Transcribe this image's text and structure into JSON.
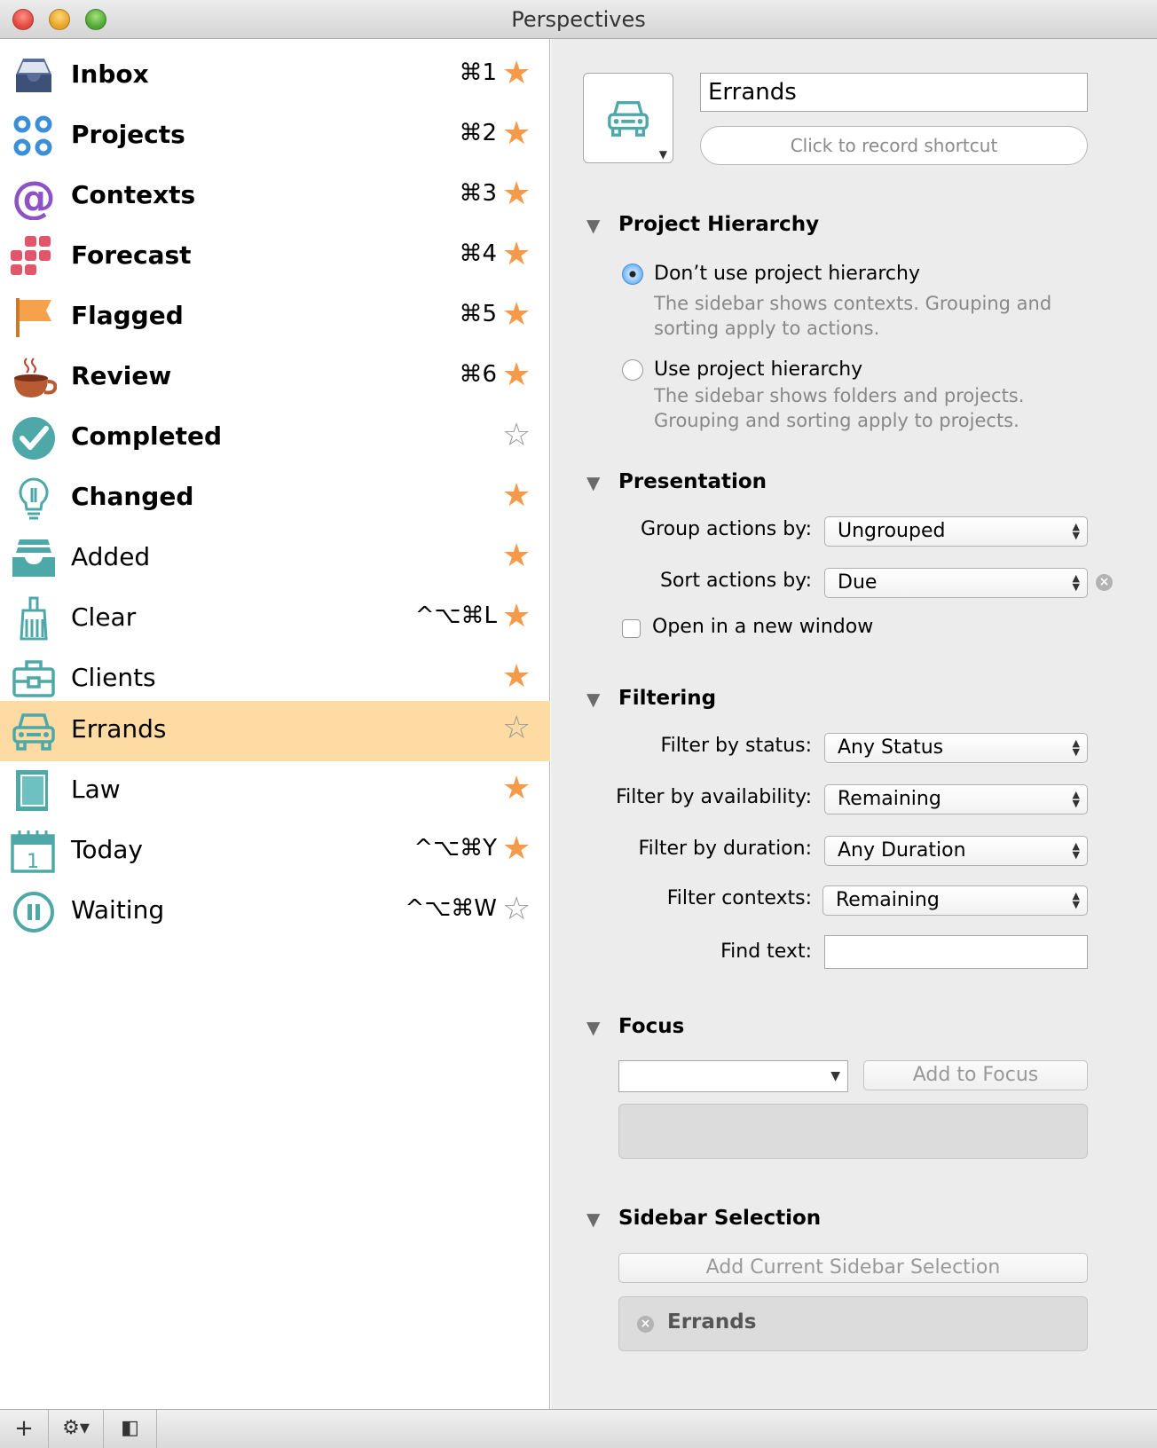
{
  "window": {
    "title": "Perspectives"
  },
  "colors": {
    "accent": "#f59a4a",
    "selection": "#fddba2",
    "teal": "#4fa8a8"
  },
  "sidebar": {
    "items": [
      {
        "label": "Inbox",
        "shortcut": "⌘1",
        "starred": true,
        "icon": "inbox-icon"
      },
      {
        "label": "Projects",
        "shortcut": "⌘2",
        "starred": true,
        "icon": "projects-icon"
      },
      {
        "label": "Contexts",
        "shortcut": "⌘3",
        "starred": true,
        "icon": "contexts-at-icon"
      },
      {
        "label": "Forecast",
        "shortcut": "⌘4",
        "starred": true,
        "icon": "forecast-grid-icon"
      },
      {
        "label": "Flagged",
        "shortcut": "⌘5",
        "starred": true,
        "icon": "flag-icon"
      },
      {
        "label": "Review",
        "shortcut": "⌘6",
        "starred": true,
        "icon": "coffee-cup-icon"
      },
      {
        "label": "Completed",
        "shortcut": "",
        "starred": false,
        "icon": "checkmark-icon"
      },
      {
        "label": "Changed",
        "shortcut": "",
        "starred": true,
        "icon": "lightbulb-icon"
      },
      {
        "label": "Added",
        "shortcut": "",
        "starred": true,
        "icon": "stacked-trays-icon"
      },
      {
        "label": "Clear",
        "shortcut": "^⌥⌘L",
        "starred": true,
        "icon": "broom-icon"
      },
      {
        "label": "Clients",
        "shortcut": "",
        "starred": true,
        "icon": "briefcase-icon"
      },
      {
        "label": "Errands",
        "shortcut": "",
        "starred": false,
        "icon": "car-icon"
      },
      {
        "label": "Law",
        "shortcut": "",
        "starred": true,
        "icon": "book-icon"
      },
      {
        "label": "Today",
        "shortcut": "^⌥⌘Y",
        "starred": true,
        "icon": "calendar-icon"
      },
      {
        "label": "Waiting",
        "shortcut": "^⌥⌘W",
        "starred": false,
        "icon": "pause-icon"
      }
    ],
    "selected": "Errands"
  },
  "editor": {
    "icon": "car-icon",
    "name": "Errands",
    "shortcut_label": "Click to record shortcut",
    "hierarchy": {
      "title": "Project Hierarchy",
      "opt1": "Don’t use project hierarchy",
      "opt1_desc1": "The sidebar shows contexts. Grouping and",
      "opt1_desc2": "sorting apply to actions.",
      "opt2": "Use project hierarchy",
      "opt2_desc1": "The sidebar shows folders and projects.",
      "opt2_desc2": "Grouping and sorting apply to projects.",
      "selected": "opt1"
    },
    "presentation": {
      "title": "Presentation",
      "group_label": "Group actions by:",
      "group_value": "Ungrouped",
      "sort_label": "Sort actions by:",
      "sort_value": "Due",
      "new_window_label": "Open in a new window",
      "new_window_checked": false
    },
    "filtering": {
      "title": "Filtering",
      "status_label": "Filter by status:",
      "status_value": "Any Status",
      "availability_label": "Filter by availability:",
      "availability_value": "Remaining",
      "duration_label": "Filter by duration:",
      "duration_value": "Any Duration",
      "contexts_label": "Filter contexts:",
      "contexts_value": "Remaining",
      "find_label": "Find text:",
      "find_value": ""
    },
    "focus": {
      "title": "Focus",
      "combo_value": "",
      "add_button": "Add to Focus"
    },
    "sidebar_selection": {
      "title": "Sidebar Selection",
      "add_button": "Add Current Sidebar Selection",
      "item": "Errands"
    }
  },
  "bottombar": {
    "add": "+",
    "gear": "⚙▾",
    "toggle": "◧"
  }
}
